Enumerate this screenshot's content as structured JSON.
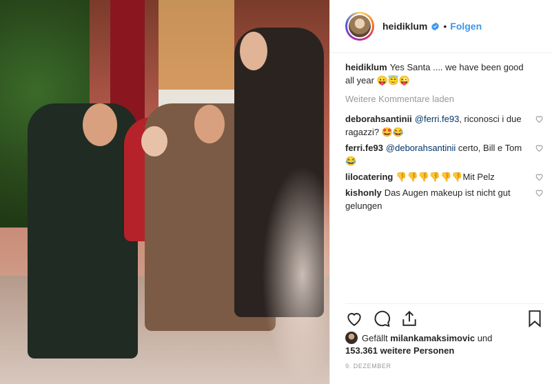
{
  "post": {
    "username": "heidiklum",
    "follow_label": "Folgen",
    "separator": "•",
    "caption_user": "heidiklum",
    "caption_text": "Yes Santa .... we have been good all year 😛😇😜",
    "load_more_label": "Weitere Kommentare laden",
    "comments": [
      {
        "user": "deborahsantinii",
        "mention": "@ferri.fe93",
        "text": ", riconosci i due ragazzi? 🤩😂"
      },
      {
        "user": "ferri.fe93",
        "mention": "@deborahsantinii",
        "text": " certo, Bill e Tom 😂"
      },
      {
        "user": "lilocatering",
        "mention": "",
        "text": "👎👎👎👎👎👎Mit Pelz"
      },
      {
        "user": "kishonly",
        "mention": "",
        "text": "Das Augen makeup ist nicht gut gelungen"
      }
    ],
    "likes_prefix": "Gefällt",
    "likes_user": "milankamaksimovic",
    "likes_and": "und",
    "likes_others": "153.361 weitere Personen",
    "date": "9. DEZEMBER"
  },
  "icons": {
    "verified": "verified-badge-icon",
    "heart": "heart-icon",
    "comment": "comment-icon",
    "share": "share-icon",
    "save": "bookmark-icon"
  },
  "colors": {
    "link": "#3897f0",
    "mention": "#003569",
    "muted": "#999999"
  }
}
